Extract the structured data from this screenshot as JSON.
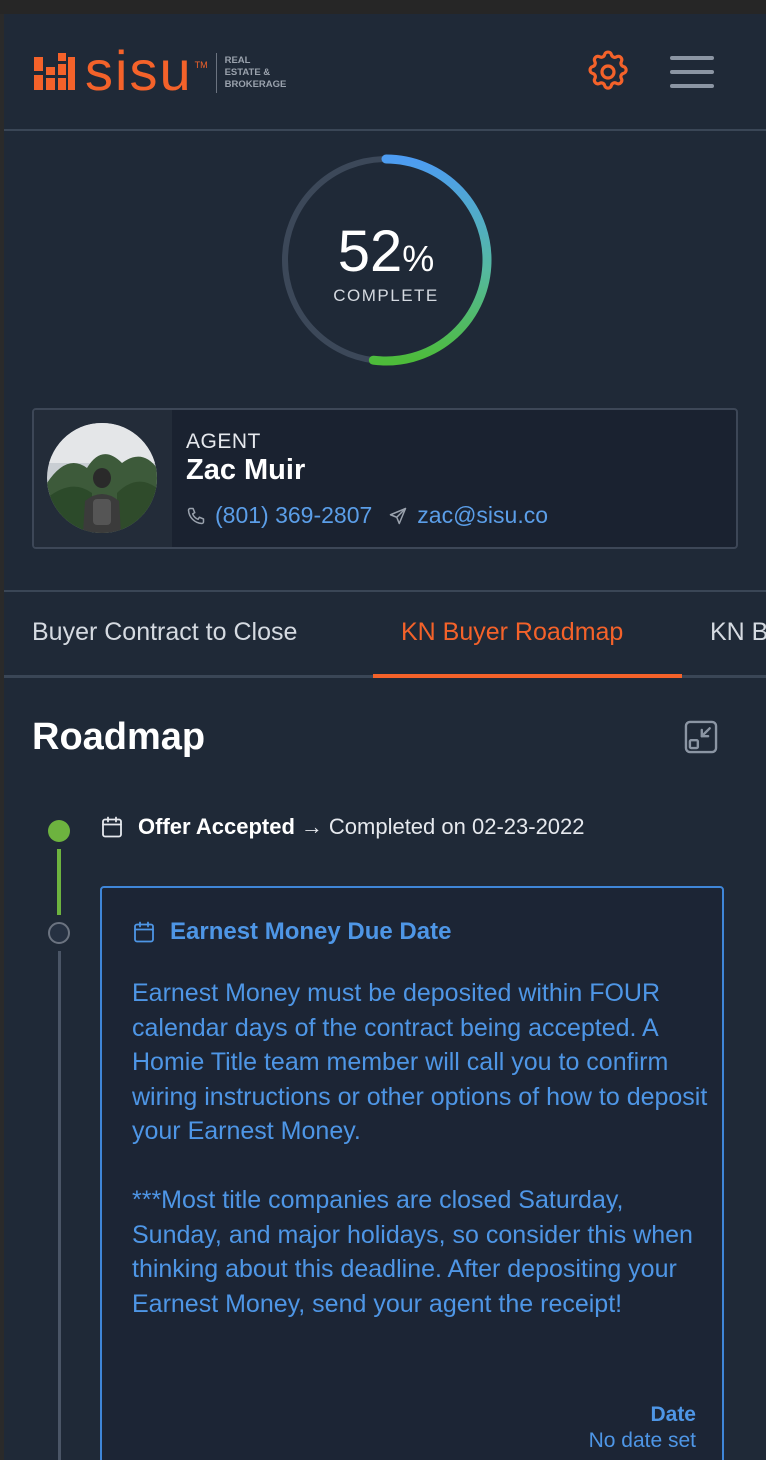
{
  "brand": {
    "name": "SiSU",
    "tm": "TM",
    "sub": [
      "REAL",
      "ESTATE &",
      "BROKERAGE"
    ],
    "accent": "#f4622a"
  },
  "header": {
    "settings_icon": "gear-icon",
    "menu_icon": "hamburger-icon"
  },
  "progress": {
    "value": 52,
    "value_text": "52",
    "symbol": "%",
    "label": "COMPLETE"
  },
  "agent": {
    "role": "AGENT",
    "name": "Zac Muir",
    "phone": "(801) 369-2807",
    "email": "zac@sisu.co"
  },
  "tabs": [
    {
      "label": "Buyer Contract to Close"
    },
    {
      "label": "KN Buyer Roadmap"
    },
    {
      "label": "KN Buyer Checklist"
    }
  ],
  "roadmap": {
    "title": "Roadmap",
    "events": [
      {
        "title": "Offer Accepted",
        "arrow": "→",
        "status": "Completed on 02-23-2022"
      },
      {
        "title": "Earnest Money Due Date",
        "body": "Earnest Money must be deposited within FOUR calendar days of the contract being accepted. A Homie Title team member will call you to confirm wiring instructions or other options of how to deposit your Earnest Money.\n\n***Most title companies are closed Saturday, Sunday, and major holidays, so consider this when thinking about this deadline. After depositing your Earnest Money, send your agent the receipt!",
        "date_label": "Date",
        "date_value": "No date set"
      }
    ]
  }
}
